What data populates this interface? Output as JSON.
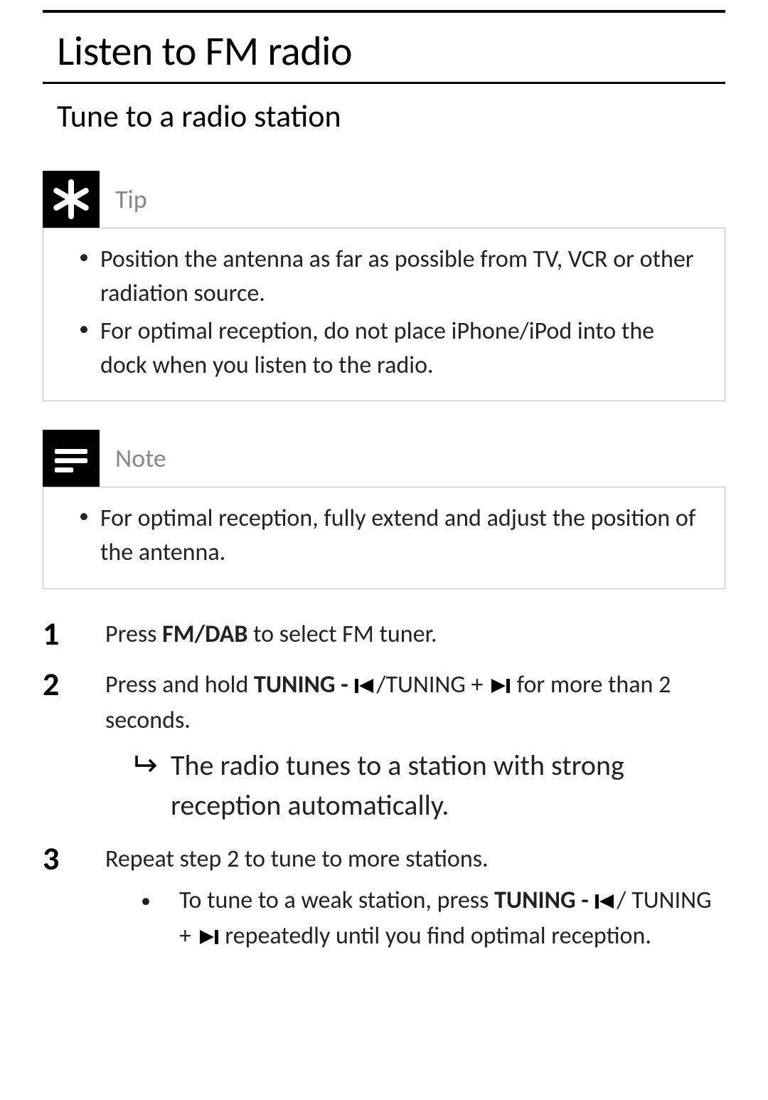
{
  "h1": "Listen to FM radio",
  "h2": "Tune to a radio station",
  "tip": {
    "label": "Tip",
    "items": [
      "Position the antenna as far as possible from TV, VCR or other radiation source.",
      "For optimal reception, do not place iPhone/iPod into the dock when you listen to the radio."
    ]
  },
  "note": {
    "label": "Note",
    "items": [
      "For optimal reception, fully extend and adjust the position of the antenna."
    ]
  },
  "steps": {
    "s1": {
      "num": "1",
      "pre": "Press ",
      "bold": "FM/DAB",
      "post": " to select FM tuner."
    },
    "s2": {
      "num": "2",
      "pre": "Press and hold ",
      "bold1": "TUNING - ",
      "mid": "/TUNING + ",
      "post": " for more than 2 seconds.",
      "result": "The radio tunes to a station with strong reception automatically."
    },
    "s3": {
      "num": "3",
      "text": "Repeat step 2 to tune to more stations.",
      "sub_pre": "To tune to a weak station, press ",
      "sub_bold1": "TUNING - ",
      "sub_mid": "/ TUNING + ",
      "sub_post": " repeatedly until you find optimal reception."
    }
  }
}
